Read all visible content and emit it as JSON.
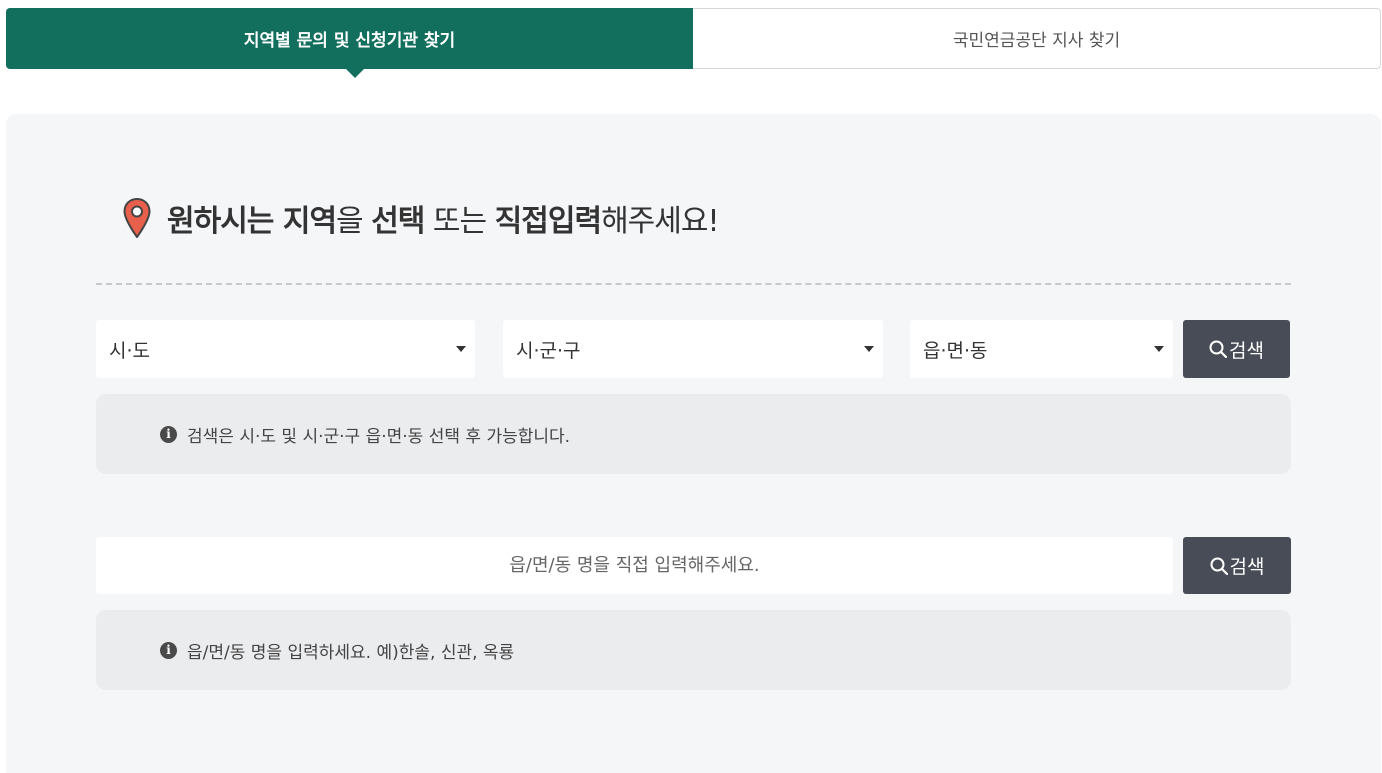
{
  "tabs": [
    {
      "label": "지역별 문의 및 신청기관 찾기",
      "active": true
    },
    {
      "label": "국민연금공단 지사 찾기",
      "active": false
    }
  ],
  "heading": {
    "part1": "원하시는 지역",
    "part2": "을 ",
    "part3": "선택",
    "part4": " 또는 ",
    "part5": "직접입력",
    "part6": "해주세요!"
  },
  "selects": {
    "sido": "시·도",
    "sigungu": "시·군·구",
    "eupmyeondong": "읍·면·동"
  },
  "buttons": {
    "search1": "검색",
    "search2": "검색"
  },
  "info": {
    "select_notice": "검색은 시·도 및 시·군·구 읍·면·동 선택 후 가능합니다.",
    "input_notice": "읍/면/동 명을 입력하세요. 예)한솔, 신관, 옥룡"
  },
  "input": {
    "placeholder": "읍/면/동 명을 직접 입력해주세요.",
    "value": ""
  },
  "colors": {
    "primary": "#136f5d",
    "button": "#484c57",
    "panel": "#f5f6f8",
    "pin": "#e8604c"
  },
  "icons": {
    "pin": "map-pin-icon",
    "search": "search-icon",
    "info": "info-icon",
    "caret": "caret-down-icon"
  }
}
